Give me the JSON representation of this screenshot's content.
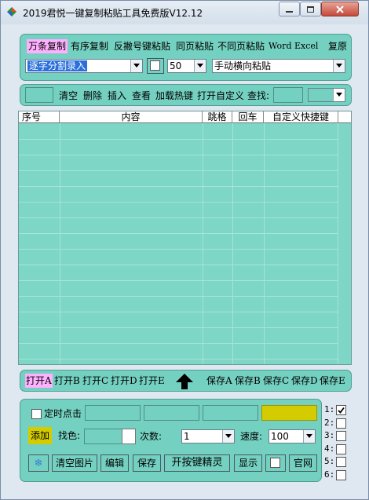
{
  "window": {
    "title": "2019君悦一键复制粘贴工具免费版V12.12",
    "minimize_glyph": "—",
    "maximize_glyph": "□",
    "close_glyph": "✕"
  },
  "toolbar": {
    "modes": [
      {
        "label": "万条复制",
        "active": true
      },
      {
        "label": "有序复制",
        "active": false
      },
      {
        "label": "反撇号键粘贴",
        "active": false
      },
      {
        "label": "同页粘贴",
        "active": false
      },
      {
        "label": "不同页粘贴",
        "active": false
      },
      {
        "label": "Word",
        "active": false
      },
      {
        "label": "Excel",
        "active": false
      },
      {
        "label": "复原",
        "active": false
      }
    ],
    "input_mode_select": "逐字分割录入",
    "count_select": "50",
    "paste_mode_select": "手动横向粘贴"
  },
  "actions": {
    "clear": "清空",
    "delete": "删除",
    "insert": "插入",
    "view": "查看",
    "load_hotkeys": "加载热键",
    "open_custom": "打开自定义",
    "find_label": "查找:"
  },
  "table": {
    "columns": [
      "序号",
      "内容",
      "跳格",
      "回车",
      "自定义快捷键"
    ],
    "rows": []
  },
  "file_bar": {
    "open": [
      "打开A",
      "打开B",
      "打开C",
      "打开D",
      "打开E"
    ],
    "arrow_icon": "up-arrow-icon",
    "save": [
      "保存A",
      "保存B",
      "保存C",
      "保存D",
      "保存E"
    ]
  },
  "bottom": {
    "timed_click_label": "定时点击",
    "add_label": "添加",
    "find_color_label": "找色:",
    "times_label": "次数:",
    "times_value": "1",
    "speed_label": "速度:",
    "speed_value": "100",
    "snowflake_icon": "snowflake-icon",
    "buttons": [
      "清空图片",
      "编辑",
      "保存",
      "开按键精灵",
      "显示",
      "官网"
    ],
    "indicator_color": "#d4cc00",
    "add_color": "#d4cc00"
  },
  "side_checks": [
    {
      "label": "1:",
      "checked": true
    },
    {
      "label": "2:",
      "checked": false
    },
    {
      "label": "3:",
      "checked": false
    },
    {
      "label": "4:",
      "checked": false
    },
    {
      "label": "5:",
      "checked": false
    },
    {
      "label": "6:",
      "checked": false
    }
  ],
  "colors": {
    "panel": "#74d0c0",
    "grid": "#7dd6c6",
    "active_mode": "#ffb0ff",
    "selected_text": "#2a6fdc"
  }
}
